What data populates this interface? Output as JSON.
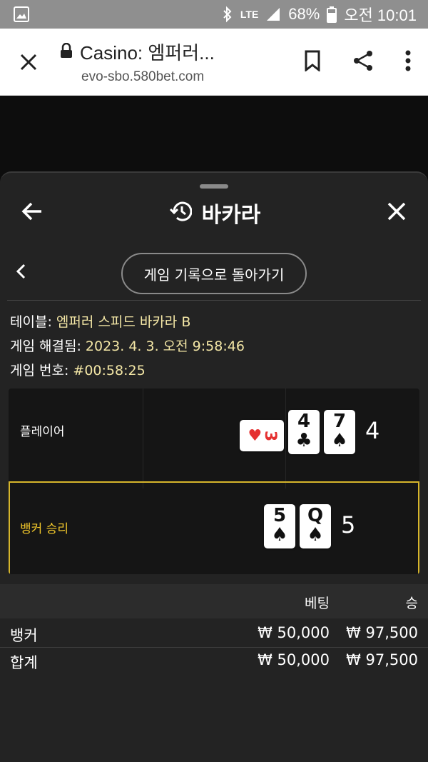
{
  "status_bar": {
    "battery": "68%",
    "network": "LTE",
    "time": "오전 10:01"
  },
  "browser": {
    "title": "Casino: 엠퍼러...",
    "url": "evo-sbo.580bet.com"
  },
  "panel": {
    "title": "바카라",
    "back_to_history": "게임 기록으로 돌아가기"
  },
  "info": {
    "table_label": "테이블:",
    "table_value": "엠퍼러 스피드 바카라 B",
    "resolved_label": "게임 해결됨:",
    "resolved_value": "2023. 4. 3. 오전 9:58:46",
    "game_no_label": "게임 번호:",
    "game_no_value": "#00:58:25"
  },
  "result": {
    "player_label": "플레이어",
    "player_score": "4",
    "player_cards": [
      {
        "rank": "3",
        "suit": "♥",
        "color": "#e53030",
        "rotated": true
      },
      {
        "rank": "4",
        "suit": "♣",
        "color": "#111111",
        "rotated": false
      },
      {
        "rank": "7",
        "suit": "♠",
        "color": "#111111",
        "rotated": false
      }
    ],
    "banker_label": "뱅커 승리",
    "banker_score": "5",
    "banker_cards": [
      {
        "rank": "5",
        "suit": "♠",
        "color": "#111111"
      },
      {
        "rank": "Q",
        "suit": "♠",
        "color": "#111111"
      }
    ],
    "accent_color": "#d6b52b"
  },
  "bets": {
    "header_bet": "베팅",
    "header_win": "승",
    "rows": [
      {
        "name": "뱅커",
        "bet": "₩ 50,000",
        "win": "₩ 97,500"
      },
      {
        "name": "합계",
        "bet": "₩ 50,000",
        "win": "₩ 97,500"
      }
    ]
  }
}
